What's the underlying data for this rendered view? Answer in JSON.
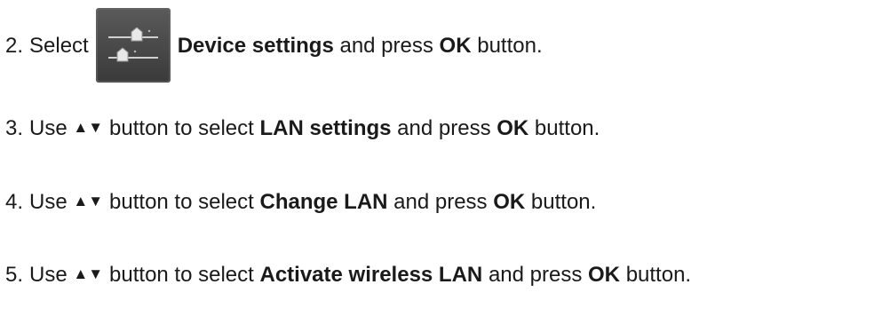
{
  "steps": [
    {
      "number": "2.",
      "pre": "Select",
      "icon": "device-settings-sliders-icon",
      "bold": "Device settings",
      "mid": "and press",
      "bold2": "OK",
      "post": "button."
    },
    {
      "number": "3.",
      "pre": "Use",
      "arrows": "▲▼",
      "mid1": "button to select",
      "bold": "LAN settings",
      "mid2": "and press",
      "bold2": "OK",
      "post": "button."
    },
    {
      "number": "4.",
      "pre": "Use",
      "arrows": "▲▼",
      "mid1": "button to select",
      "bold": "Change LAN",
      "mid2": "and press",
      "bold2": "OK",
      "post": "button."
    },
    {
      "number": "5.",
      "pre": "Use",
      "arrows": "▲▼",
      "mid1": "button to select",
      "bold": "Activate wireless LAN",
      "mid2": "and press",
      "bold2": "OK",
      "post": "button."
    }
  ],
  "colors": {
    "text": "#1a1a1a",
    "icon_bg": "#4a4a4a",
    "icon_line": "#cfcfcf"
  }
}
